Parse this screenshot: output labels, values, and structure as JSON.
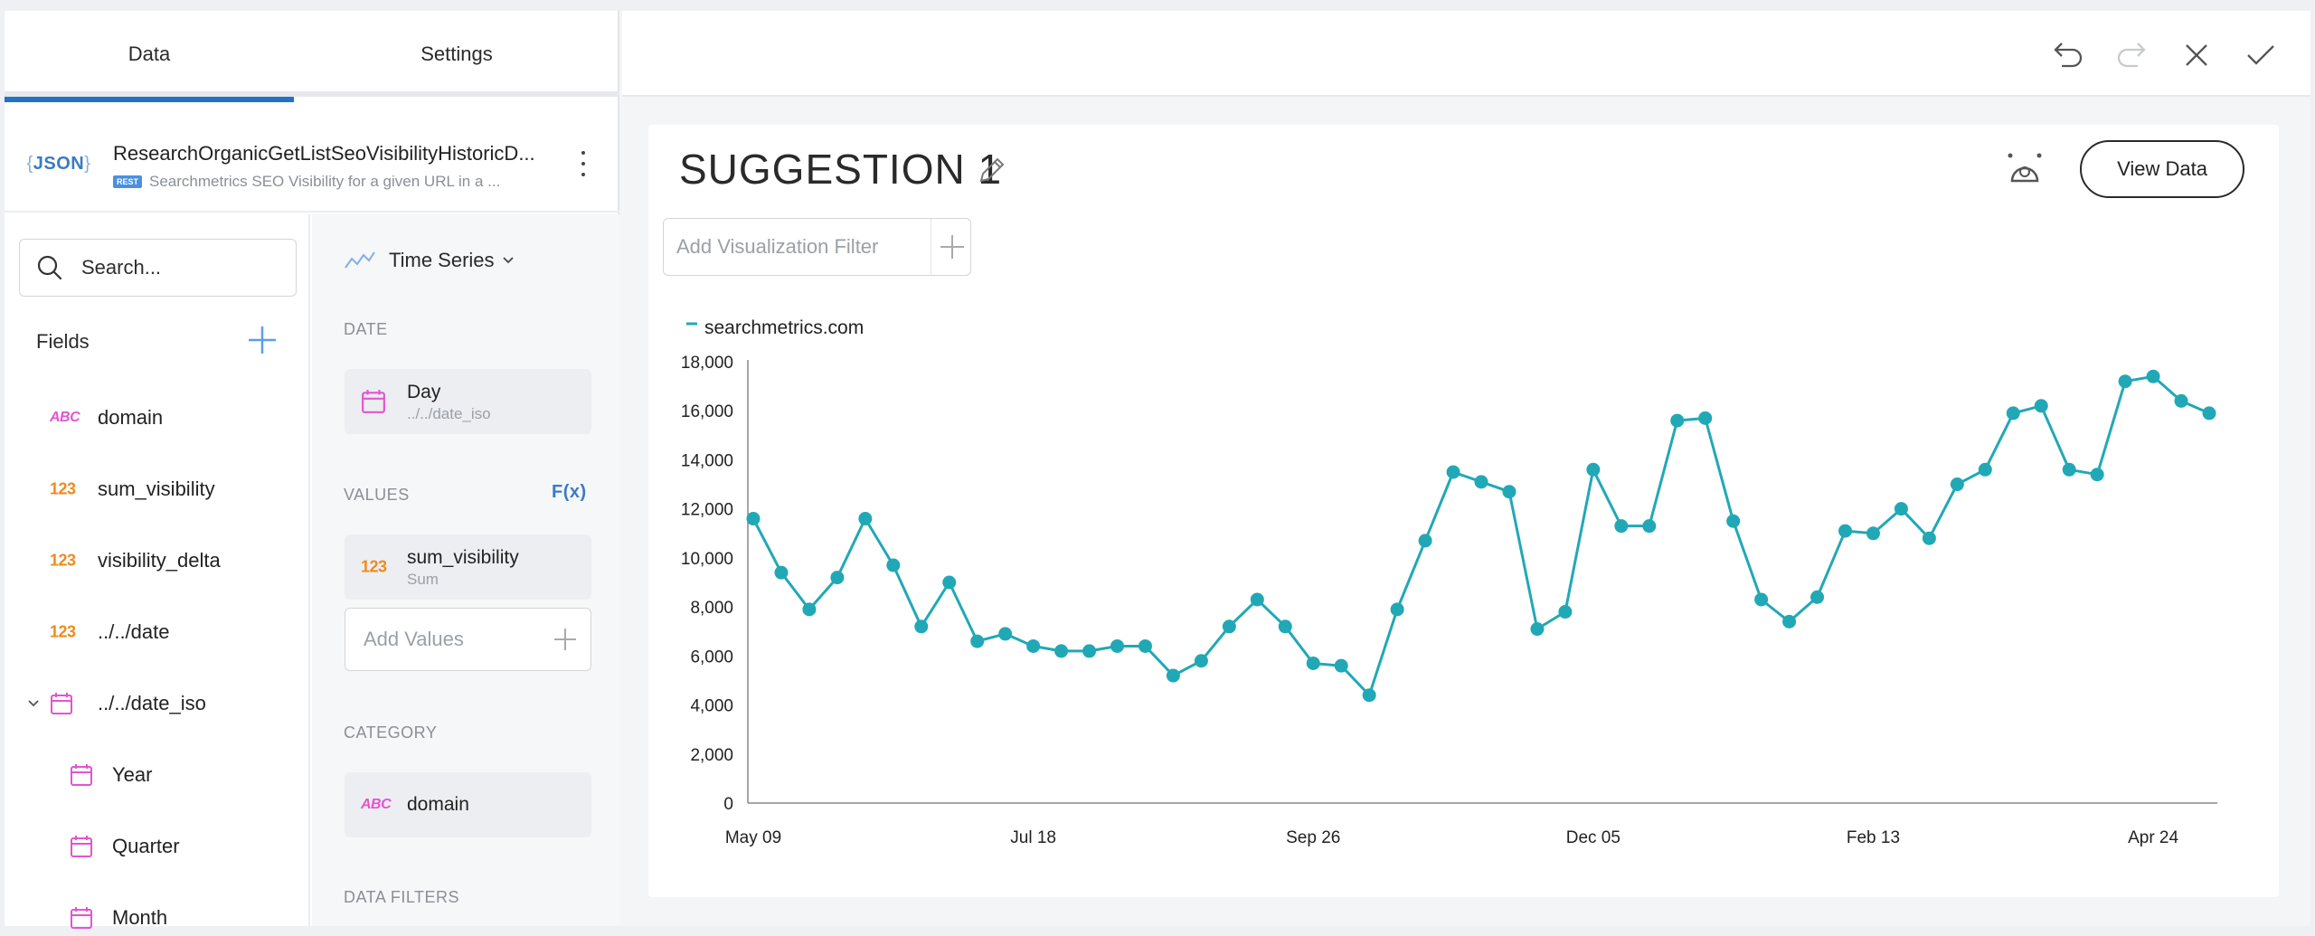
{
  "tabs": {
    "data": "Data",
    "settings": "Settings"
  },
  "source": {
    "badge": "JSON",
    "title": "ResearchOrganicGetListSeoVisibilityHistoricD...",
    "rest_tag": "REST",
    "subtitle": "Searchmetrics SEO Visibility for a given URL in a ..."
  },
  "fields_panel": {
    "search_placeholder": "Search...",
    "heading": "Fields",
    "items": [
      {
        "type": "ABC",
        "label": "domain"
      },
      {
        "type": "123",
        "label": "sum_visibility"
      },
      {
        "type": "123",
        "label": "visibility_delta"
      },
      {
        "type": "123",
        "label": "../../date"
      },
      {
        "type": "date",
        "label": "../../date_iso"
      },
      {
        "type": "date",
        "label": "Year"
      },
      {
        "type": "date",
        "label": "Quarter"
      },
      {
        "type": "date",
        "label": "Month"
      }
    ]
  },
  "config": {
    "viz_type": "Time Series",
    "date_section": "DATE",
    "date_pill": {
      "main": "Day",
      "sub": "../../date_iso"
    },
    "values_section": "VALUES",
    "fx": "F(x)",
    "values_pill": {
      "type": "123",
      "main": "sum_visibility",
      "sub": "Sum"
    },
    "add_values": "Add Values",
    "category_section": "CATEGORY",
    "category_pill": {
      "type": "ABC",
      "main": "domain"
    },
    "data_filters_section": "DATA FILTERS"
  },
  "card": {
    "title": "SUGGESTION 1",
    "view_data": "View Data",
    "filter_placeholder": "Add Visualization Filter"
  },
  "colors": {
    "accent": "#1f73c8",
    "series": "#21a8b6",
    "abc": "#e255d0",
    "num": "#f08a1e"
  },
  "chart_data": {
    "type": "line",
    "legend": [
      "searchmetrics.com"
    ],
    "series": [
      {
        "name": "searchmetrics.com",
        "values": [
          11600,
          9400,
          7900,
          9200,
          11600,
          9700,
          7200,
          9000,
          6600,
          6900,
          6400,
          6200,
          6200,
          6400,
          6400,
          5200,
          5800,
          7200,
          8300,
          7200,
          5700,
          5600,
          4400,
          7900,
          10700,
          13500,
          13100,
          12700,
          7100,
          7800,
          13600,
          11300,
          11300,
          15600,
          15700,
          11500,
          8300,
          7400,
          8400,
          11100,
          11000,
          12000,
          10800,
          13000,
          13600,
          15900,
          16200,
          13600,
          13400,
          17200,
          17400,
          16400,
          15900
        ]
      }
    ],
    "x_ticks": [
      "May 09",
      "Jul 18",
      "Sep 26",
      "Dec 05",
      "Feb 13",
      "Apr 24"
    ],
    "y_ticks": [
      "0",
      "2,000",
      "4,000",
      "6,000",
      "8,000",
      "10,000",
      "12,000",
      "14,000",
      "16,000",
      "18,000"
    ],
    "ylim": [
      0,
      18000
    ],
    "grid": false,
    "legend_position": "top-left"
  }
}
